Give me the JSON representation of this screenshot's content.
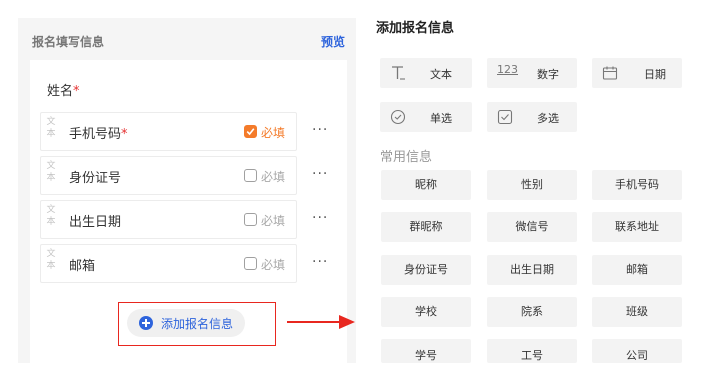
{
  "left_panel": {
    "title": "报名填写信息",
    "preview": "预览",
    "name_field": {
      "label": "姓名",
      "required_mark": "*"
    },
    "fields": [
      {
        "type_badge": "文本",
        "label": "手机号码",
        "required_mark": "*",
        "required_label": "必填",
        "required": true,
        "more": "···"
      },
      {
        "type_badge": "文本",
        "label": "身份证号",
        "required_mark": "",
        "required_label": "必填",
        "required": false,
        "more": "···"
      },
      {
        "type_badge": "文本",
        "label": "出生日期",
        "required_mark": "",
        "required_label": "必填",
        "required": false,
        "more": "···"
      },
      {
        "type_badge": "文本",
        "label": "邮箱",
        "required_mark": "",
        "required_label": "必填",
        "required": false,
        "more": "···"
      }
    ],
    "add_button": "添加报名信息"
  },
  "right_panel": {
    "title": "添加报名信息",
    "types": [
      {
        "icon": "text-icon",
        "label": "文本"
      },
      {
        "icon": "number-icon",
        "icon_text": "123",
        "label": "数字"
      },
      {
        "icon": "calendar-icon",
        "label": "日期"
      },
      {
        "icon": "radio-icon",
        "label": "单选"
      },
      {
        "icon": "checkbox-icon",
        "label": "多选"
      }
    ],
    "common_title": "常用信息",
    "common": [
      "昵称",
      "性别",
      "手机号码",
      "群昵称",
      "微信号",
      "联系地址",
      "身份证号",
      "出生日期",
      "邮箱",
      "学校",
      "院系",
      "班级",
      "学号",
      "工号",
      "公司"
    ]
  },
  "colors": {
    "accent": "#2e64dc",
    "required": "#f47b2a",
    "highlight": "#e8271f",
    "star": "#e53030"
  }
}
